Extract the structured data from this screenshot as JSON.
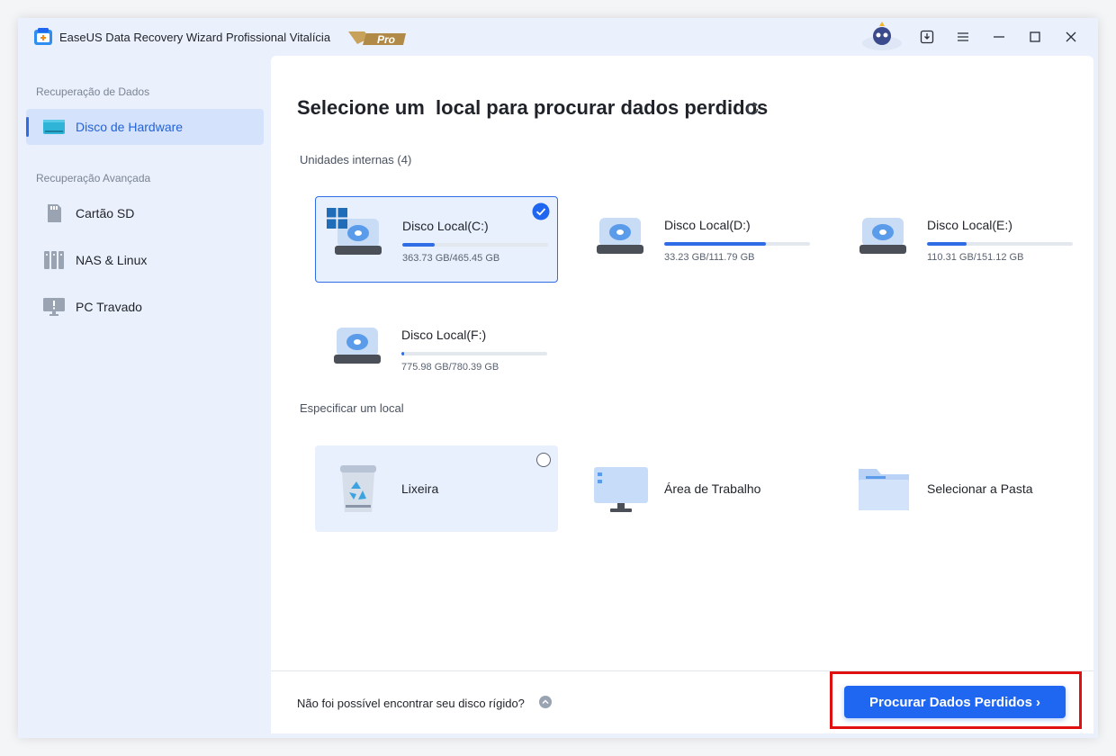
{
  "app": {
    "title": "EaseUS Data Recovery Wizard Profissional Vitalícia",
    "badge": "Pro"
  },
  "sidebar": {
    "section1": "Recuperação de Dados",
    "section2": "Recuperação Avançada",
    "items": [
      {
        "label": "Disco de Hardware",
        "icon": "hard-drive-icon",
        "active": true
      },
      {
        "label": "Cartão SD",
        "icon": "sd-card-icon",
        "active": false
      },
      {
        "label": "NAS & Linux",
        "icon": "nas-icon",
        "active": false
      },
      {
        "label": "PC Travado",
        "icon": "crashed-pc-icon",
        "active": false
      }
    ]
  },
  "main": {
    "title": "Selecione um  local para procurar dados perdidos",
    "internal_label": "Unidades internas (4)",
    "drives": [
      {
        "name": "Disco Local(C:)",
        "size": "363.73 GB/465.45 GB",
        "used_fraction": 0.22,
        "selected": true
      },
      {
        "name": "Disco Local(D:)",
        "size": "33.23 GB/111.79 GB",
        "used_fraction": 0.7,
        "selected": false
      },
      {
        "name": "Disco Local(E:)",
        "size": "110.31 GB/151.12 GB",
        "used_fraction": 0.27,
        "selected": false
      },
      {
        "name": "Disco Local(F:)",
        "size": "775.98 GB/780.39 GB",
        "used_fraction": 0.02,
        "selected": false
      }
    ],
    "specify_label": "Especificar um local",
    "locations": [
      {
        "label": "Lixeira",
        "icon": "recycle-bin-icon"
      },
      {
        "label": "Área de Trabalho",
        "icon": "desktop-icon"
      },
      {
        "label": "Selecionar a Pasta",
        "icon": "folder-icon"
      }
    ]
  },
  "footer": {
    "help_text": "Não foi possível encontrar seu disco rígido?",
    "scan_button": "Procurar Dados Perdidos"
  },
  "colors": {
    "accent": "#1f66f0",
    "highlight": "#e01010",
    "sidebar_bg": "#eaf0fc"
  }
}
